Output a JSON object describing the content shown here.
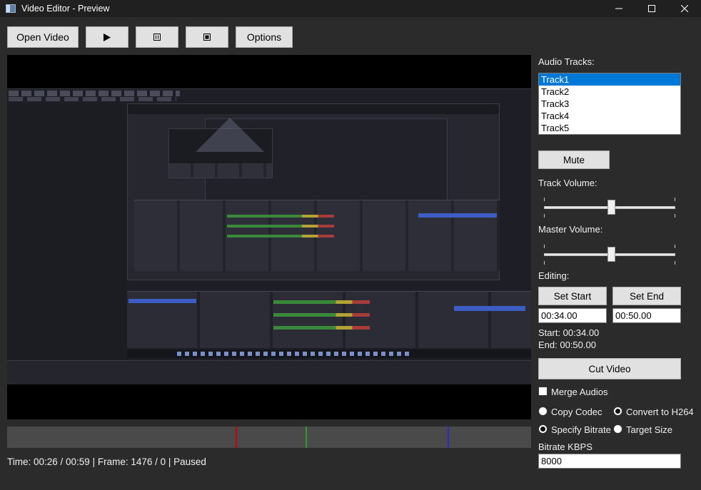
{
  "window": {
    "title": "Video Editor - Preview"
  },
  "toolbar": {
    "open_video": "Open Video",
    "options": "Options"
  },
  "status": {
    "text": "Time: 00:26 / 00:59 | Frame: 1476 / 0 | Paused"
  },
  "timeline": {
    "markers": [
      {
        "color": "#cc0000",
        "position_fraction": 0.436
      },
      {
        "color": "#2a9d2a",
        "position_fraction": 0.57
      },
      {
        "color": "#2a2ad0",
        "position_fraction": 0.84
      }
    ]
  },
  "audio": {
    "label": "Audio Tracks:",
    "tracks": [
      "Track1",
      "Track2",
      "Track3",
      "Track4",
      "Track5"
    ],
    "selected_index": 0,
    "mute_label": "Mute",
    "track_volume_label": "Track Volume:",
    "track_volume_fraction": 0.5,
    "master_volume_label": "Master Volume:",
    "master_volume_fraction": 0.5
  },
  "editing": {
    "label": "Editing:",
    "set_start": "Set Start",
    "set_end": "Set End",
    "start_value": "00:34.00",
    "end_value": "00:50.00",
    "start_text": "Start: 00:34.00",
    "end_text": "End: 00:50.00",
    "cut_video": "Cut Video",
    "merge_audios": "Merge Audios",
    "merge_audios_checked": false
  },
  "encoding": {
    "copy_codec": "Copy Codec",
    "convert_h264": "Convert to H264",
    "specify_bitrate": "Specify Bitrate",
    "target_size": "Target Size",
    "codec_selected": "convert_h264",
    "bitrate_mode_selected": "specify_bitrate",
    "bitrate_label": "Bitrate KBPS",
    "bitrate_value": "8000"
  },
  "icons": {
    "play": "play-icon",
    "pause": "pause-icon",
    "stop": "stop-icon"
  }
}
